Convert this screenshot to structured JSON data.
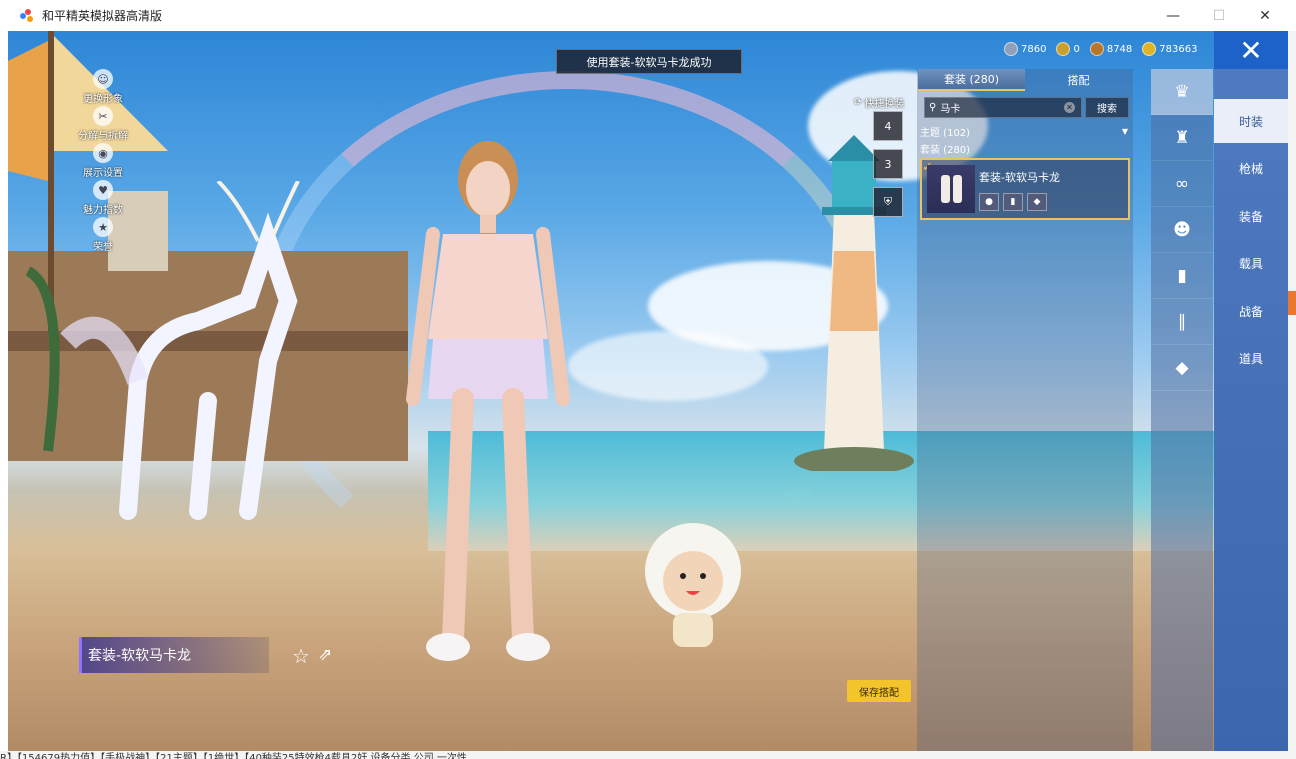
{
  "window": {
    "title": "和平精英模拟器高清版",
    "controls": {
      "minimize": "—",
      "maximize": "☐",
      "close": "✕"
    }
  },
  "toast": "使用套装-软软马卡龙成功",
  "currency": [
    {
      "icon": "diamond-coin-icon",
      "value": "7860",
      "color": "#8fa0b8"
    },
    {
      "icon": "gold-token-icon",
      "value": "0",
      "color": "#c8a030"
    },
    {
      "icon": "bronze-coin-icon",
      "value": "8748",
      "color": "#b6762c"
    },
    {
      "icon": "gold-coin-icon",
      "value": "783663",
      "color": "#e0b428"
    }
  ],
  "left_menu": [
    {
      "label": "更换形象",
      "icon": "person-icon"
    },
    {
      "label": "分解与拆解",
      "icon": "dismantle-icon"
    },
    {
      "label": "展示设置",
      "icon": "eye-icon"
    },
    {
      "label": "魅力指数",
      "icon": "charm-icon"
    },
    {
      "label": "荣誉",
      "icon": "honor-icon"
    }
  ],
  "quick_switch": {
    "label": "快捷换装",
    "slots": [
      "4",
      "3",
      ""
    ]
  },
  "panel": {
    "tabs": [
      {
        "label": "套装 (280)",
        "active": true
      },
      {
        "label": "搭配",
        "active": false
      }
    ],
    "search": {
      "value": "马卡",
      "button": "搜索"
    },
    "theme_filter": "主题 (102)",
    "suit_count": "套装 (280)",
    "selected_item": {
      "name": "套装-软软马卡龙",
      "checked": true
    }
  },
  "icon_column": [
    {
      "icon": "outfit-icon",
      "active": true
    },
    {
      "icon": "hat-icon",
      "active": false
    },
    {
      "icon": "glasses-icon",
      "active": false
    },
    {
      "icon": "mask-icon",
      "active": false
    },
    {
      "icon": "top-icon",
      "active": false
    },
    {
      "icon": "pants-icon",
      "active": false
    },
    {
      "icon": "shoes-icon",
      "active": false
    }
  ],
  "categories": [
    {
      "label": "时装",
      "active": true
    },
    {
      "label": "枪械",
      "active": false
    },
    {
      "label": "装备",
      "active": false
    },
    {
      "label": "载具",
      "active": false
    },
    {
      "label": "战备",
      "active": false
    },
    {
      "label": "道具",
      "active": false
    }
  ],
  "outfit_name": "套装-软软马卡龙",
  "save_button": "保存搭配",
  "accent_color": "#f3c42b",
  "background_text": "R】【154679热力值】【手极战神】【21主题】【1绝世】【40种装25特效枪4载具2奸   设备分类   公司   一次性"
}
